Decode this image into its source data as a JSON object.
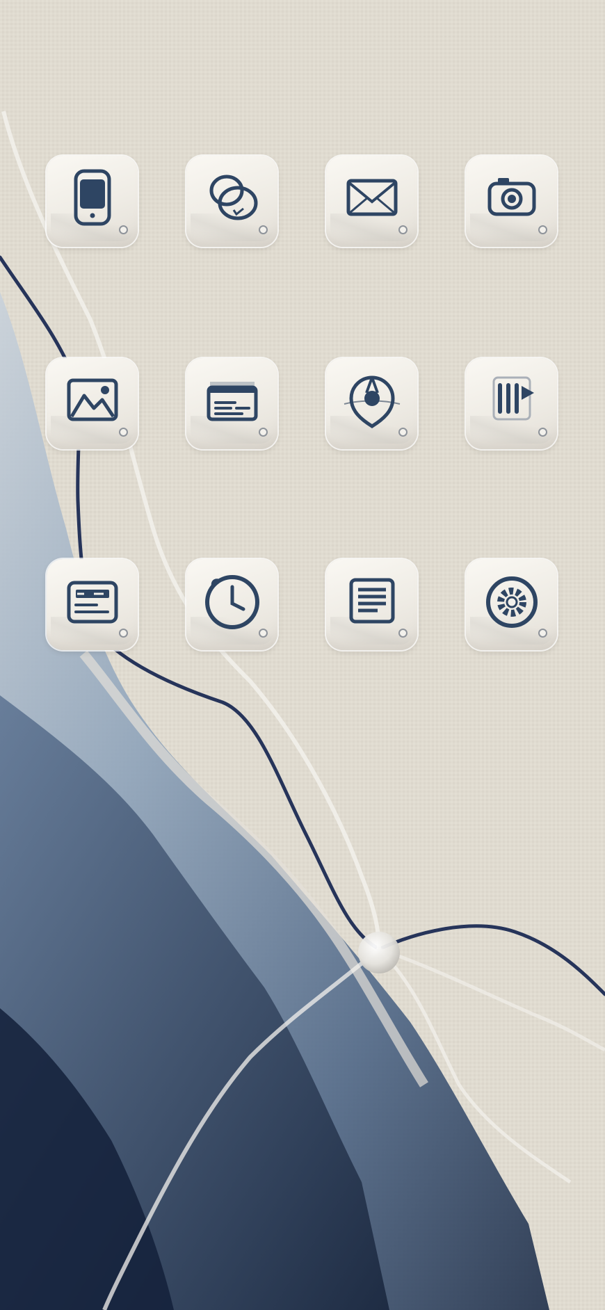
{
  "screen": {
    "type": "home-screen",
    "theme": {
      "linen": "#ddd7cd",
      "ink_blue": "#2f4566",
      "ink_light": "#8fa4bc",
      "icon_stroke": "#2e4563"
    }
  },
  "wallpaper": {
    "description_icons": [
      "linen-texture",
      "watercolor-ink",
      "navy-thread",
      "clear-cord",
      "glass-bead"
    ]
  },
  "apps": [
    {
      "icon": "phone-icon"
    },
    {
      "icon": "overlapping-circles-icon"
    },
    {
      "icon": "mail-icon"
    },
    {
      "icon": "camera-icon"
    },
    {
      "icon": "photos-icon"
    },
    {
      "icon": "wallet-icon"
    },
    {
      "icon": "navigation-icon"
    },
    {
      "icon": "music-bars-icon"
    },
    {
      "icon": "calendar-card-icon"
    },
    {
      "icon": "clock-icon"
    },
    {
      "icon": "notes-icon"
    },
    {
      "icon": "settings-gear-icon"
    }
  ]
}
